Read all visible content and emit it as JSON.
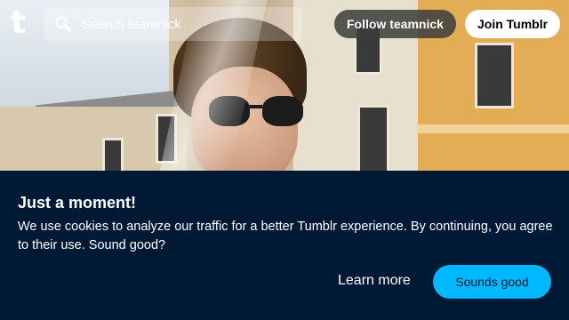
{
  "header": {
    "logo_letter": "t",
    "search": {
      "placeholder": "Search teamnick"
    },
    "follow_label": "Follow teamnick",
    "join_label": "Join Tumblr"
  },
  "cookie_banner": {
    "title": "Just a moment!",
    "message": "We use cookies to analyze our traffic for a better Tumblr experience. By continuing, you agree to their use. Sound good?",
    "learn_more_label": "Learn more",
    "accept_label": "Sounds good"
  },
  "colors": {
    "banner_bg": "#001935",
    "accent": "#00b8ff"
  },
  "icons": {
    "logo": "tumblr-logo",
    "search": "search-icon"
  }
}
